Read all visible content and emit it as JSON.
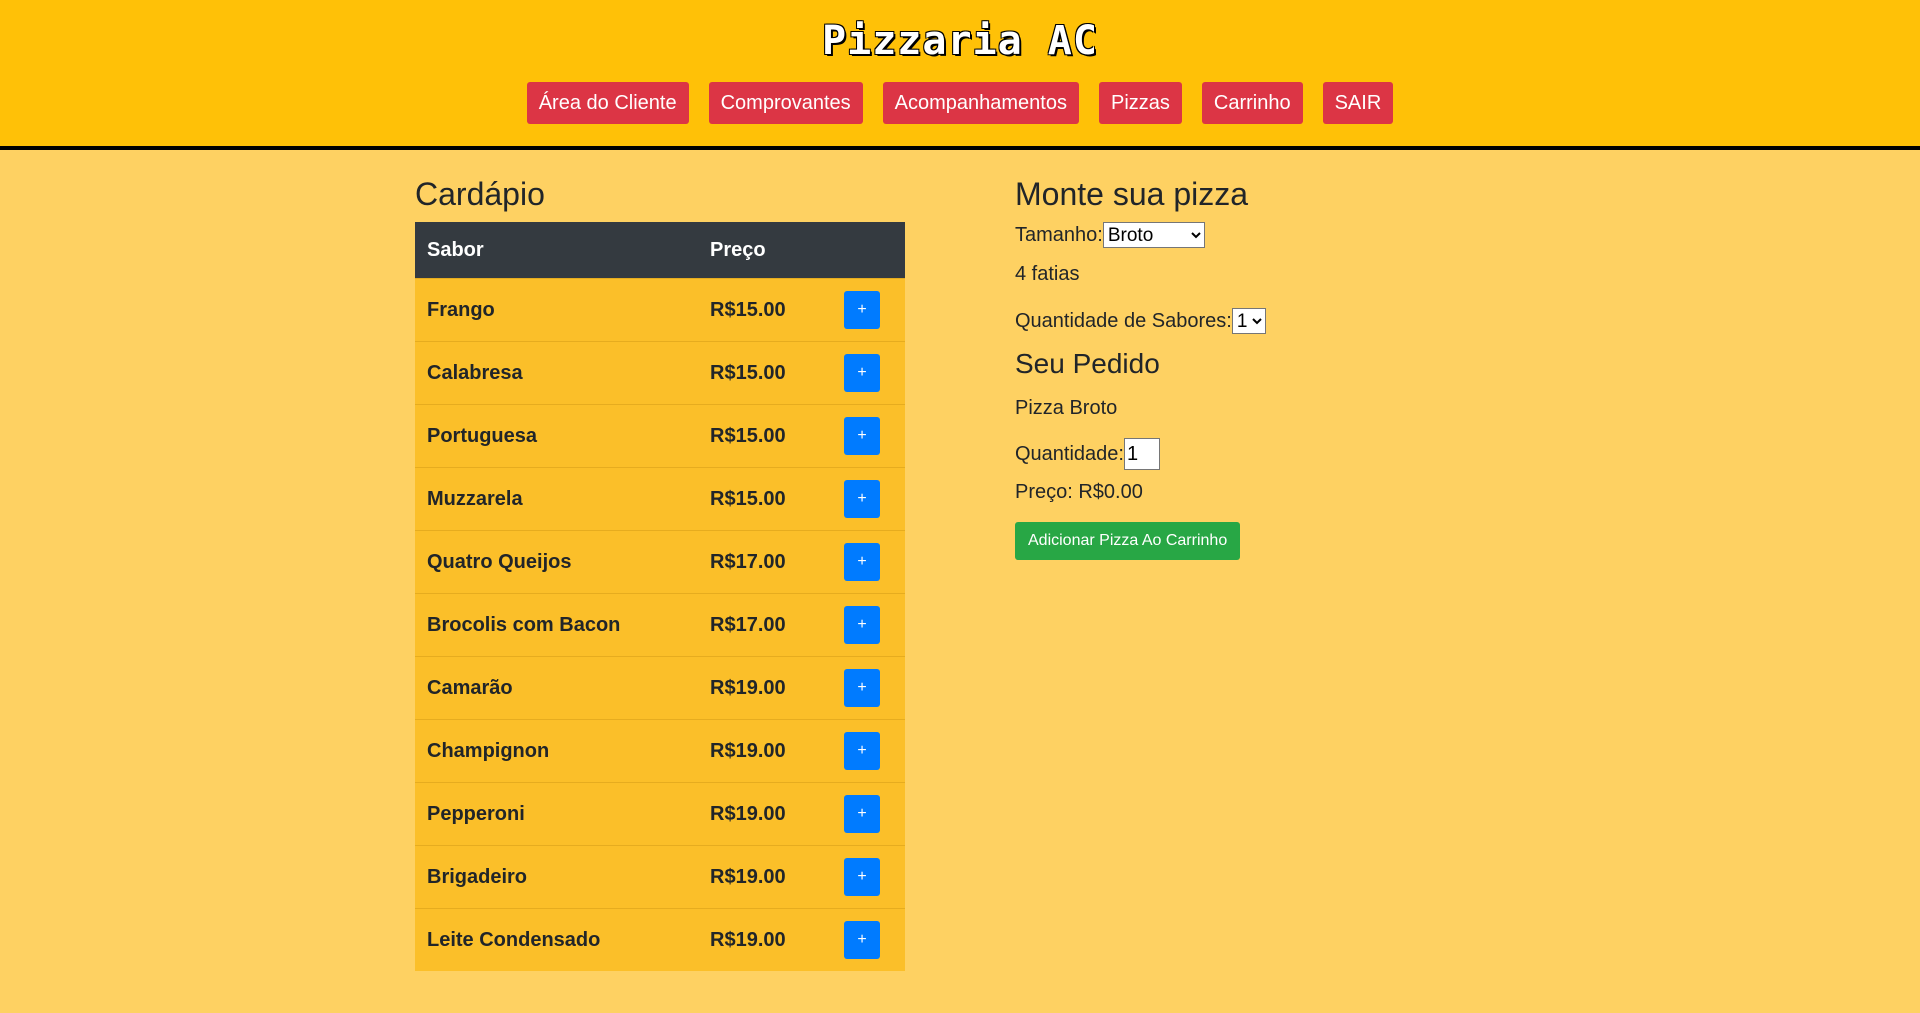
{
  "brand": {
    "logo_text": "Pizzaria AC"
  },
  "nav": {
    "items": [
      {
        "label": "Área do Cliente"
      },
      {
        "label": "Comprovantes"
      },
      {
        "label": "Acompanhamentos"
      },
      {
        "label": "Pizzas"
      },
      {
        "label": "Carrinho"
      },
      {
        "label": "SAIR"
      }
    ]
  },
  "menu": {
    "title": "Cardápio",
    "headers": {
      "flavor": "Sabor",
      "price": "Preço"
    },
    "add_label": "+",
    "rows": [
      {
        "flavor": "Frango",
        "price": "R$15.00"
      },
      {
        "flavor": "Calabresa",
        "price": "R$15.00"
      },
      {
        "flavor": "Portuguesa",
        "price": "R$15.00"
      },
      {
        "flavor": "Muzzarela",
        "price": "R$15.00"
      },
      {
        "flavor": "Quatro Queijos",
        "price": "R$17.00"
      },
      {
        "flavor": "Brocolis com Bacon",
        "price": "R$17.00"
      },
      {
        "flavor": "Camarão",
        "price": "R$19.00"
      },
      {
        "flavor": "Champignon",
        "price": "R$19.00"
      },
      {
        "flavor": "Pepperoni",
        "price": "R$19.00"
      },
      {
        "flavor": "Brigadeiro",
        "price": "R$19.00"
      },
      {
        "flavor": "Leite Condensado",
        "price": "R$19.00"
      }
    ]
  },
  "builder": {
    "title": "Monte sua pizza",
    "size_label": "Tamanho:",
    "size_value": "Broto",
    "slices": "4 fatias",
    "flavors_qty_label": "Quantidade de Sabores:",
    "flavors_qty_value": "1"
  },
  "order": {
    "title": "Seu Pedido",
    "item": "Pizza Broto",
    "qty_label": "Quantidade:",
    "qty_value": "1",
    "price_text": "Preço: R$0.00",
    "add_button": "Adicionar Pizza Ao Carrinho"
  },
  "colors": {
    "header_bg": "#ffc107",
    "page_bg": "#fed162",
    "nav_button": "#dc3545",
    "table_header": "#343a40",
    "table_row": "#fbbf29",
    "add_row_button": "#007bff",
    "add_cart_button": "#28a745"
  }
}
